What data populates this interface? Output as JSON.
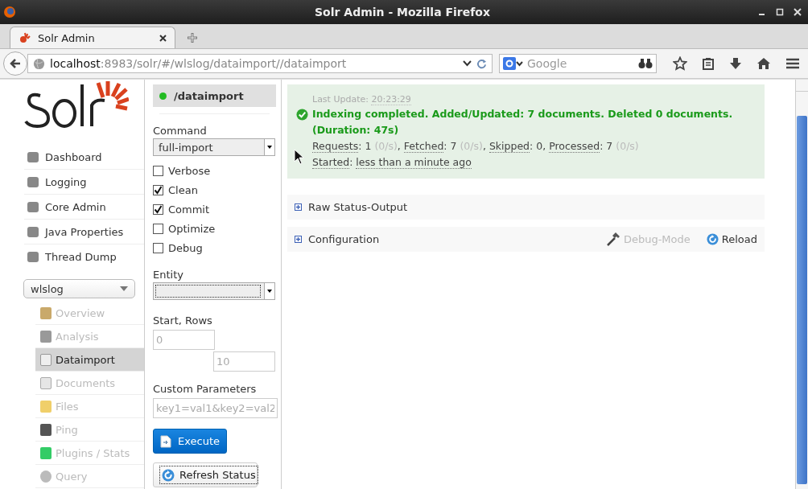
{
  "window": {
    "title": "Solr Admin - Mozilla Firefox"
  },
  "browser_tabs": [
    {
      "label": "Solr Admin",
      "selected": true
    }
  ],
  "address_bar": {
    "host": "localhost",
    "path": ":8983/solr/#/wlslog/dataimport//dataimport"
  },
  "search_field": {
    "placeholder": "Google"
  },
  "sidebar": {
    "items": [
      {
        "label": "Dashboard"
      },
      {
        "label": "Logging"
      },
      {
        "label": "Core Admin"
      },
      {
        "label": "Java Properties"
      },
      {
        "label": "Thread Dump"
      }
    ],
    "core_selector": {
      "value": "wlslog"
    },
    "core_items": [
      {
        "label": "Overview",
        "selected": false,
        "disabled": true
      },
      {
        "label": "Analysis",
        "selected": false,
        "disabled": true
      },
      {
        "label": "Dataimport",
        "selected": true,
        "disabled": false
      },
      {
        "label": "Documents",
        "selected": false,
        "disabled": true
      },
      {
        "label": "Files",
        "selected": false,
        "disabled": true
      },
      {
        "label": "Ping",
        "selected": false,
        "disabled": true
      },
      {
        "label": "Plugins / Stats",
        "selected": false,
        "disabled": true
      },
      {
        "label": "Query",
        "selected": false,
        "disabled": true
      }
    ]
  },
  "dataimport_panel": {
    "handler": "/dataimport",
    "active": true,
    "command": {
      "label": "Command",
      "value": "full-import"
    },
    "options": [
      {
        "label": "Verbose",
        "checked": false
      },
      {
        "label": "Clean",
        "checked": true
      },
      {
        "label": "Commit",
        "checked": true
      },
      {
        "label": "Optimize",
        "checked": false
      },
      {
        "label": "Debug",
        "checked": false
      }
    ],
    "entity": {
      "label": "Entity"
    },
    "start_rows": {
      "label": "Start, Rows",
      "start_placeholder": "0",
      "rows_placeholder": "10"
    },
    "custom_parameters": {
      "label": "Custom Parameters",
      "placeholder": "key1=val1&key2=val2"
    },
    "buttons": [
      {
        "label": "Execute",
        "kind": "primary"
      },
      {
        "label": "Refresh Status",
        "kind": "secondary"
      }
    ]
  },
  "status": {
    "last_update_label": "Last Update:",
    "last_update": "20:23:29",
    "message": "Indexing completed. Added/Updated: 7 documents. Deleted 0 documents. (Duration: 47s)",
    "stats": [
      {
        "label": "Requests",
        "value": ": 1",
        "rate": "(0/s)",
        "separator": ","
      },
      {
        "label": "Fetched",
        "value": ": 7",
        "rate": "(0/s)",
        "separator": ","
      },
      {
        "label": "Skipped",
        "value": ": 0,"
      },
      {
        "label": "Processed",
        "value": ": 7",
        "rate": "(0/s)"
      }
    ],
    "started_label": "Started",
    "started_value": ": ",
    "started": "less than a minute ago"
  },
  "sections": [
    {
      "label": "Raw Status-Output",
      "expanded": false
    },
    {
      "label": "Configuration",
      "expanded": false,
      "actions": [
        {
          "label": "Debug-Mode",
          "disabled": true
        },
        {
          "label": "Reload",
          "disabled": false
        }
      ]
    }
  ]
}
